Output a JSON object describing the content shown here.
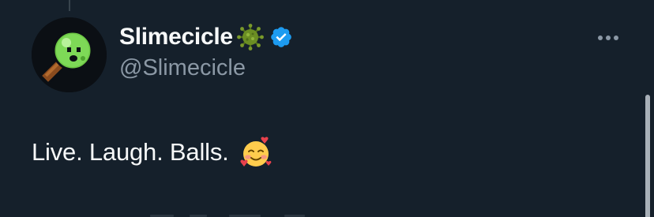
{
  "tweet": {
    "author": {
      "display_name": "Slimecicle",
      "handle": "@Slimecicle",
      "name_emoji": "virus-emoji",
      "verified": true,
      "avatar": "slime-popsicle-avatar"
    },
    "text": "Live. Laugh. Balls.",
    "text_emoji": "smiling-face-with-hearts-emoji",
    "more_icon": "more-horizontal-icon"
  },
  "colors": {
    "background": "#15202b",
    "name": "#f7f9f9",
    "handle": "#8b98a5",
    "verified": "#1d9bf0",
    "more_icon": "#8b98a5",
    "virus": "#6b8e23"
  }
}
